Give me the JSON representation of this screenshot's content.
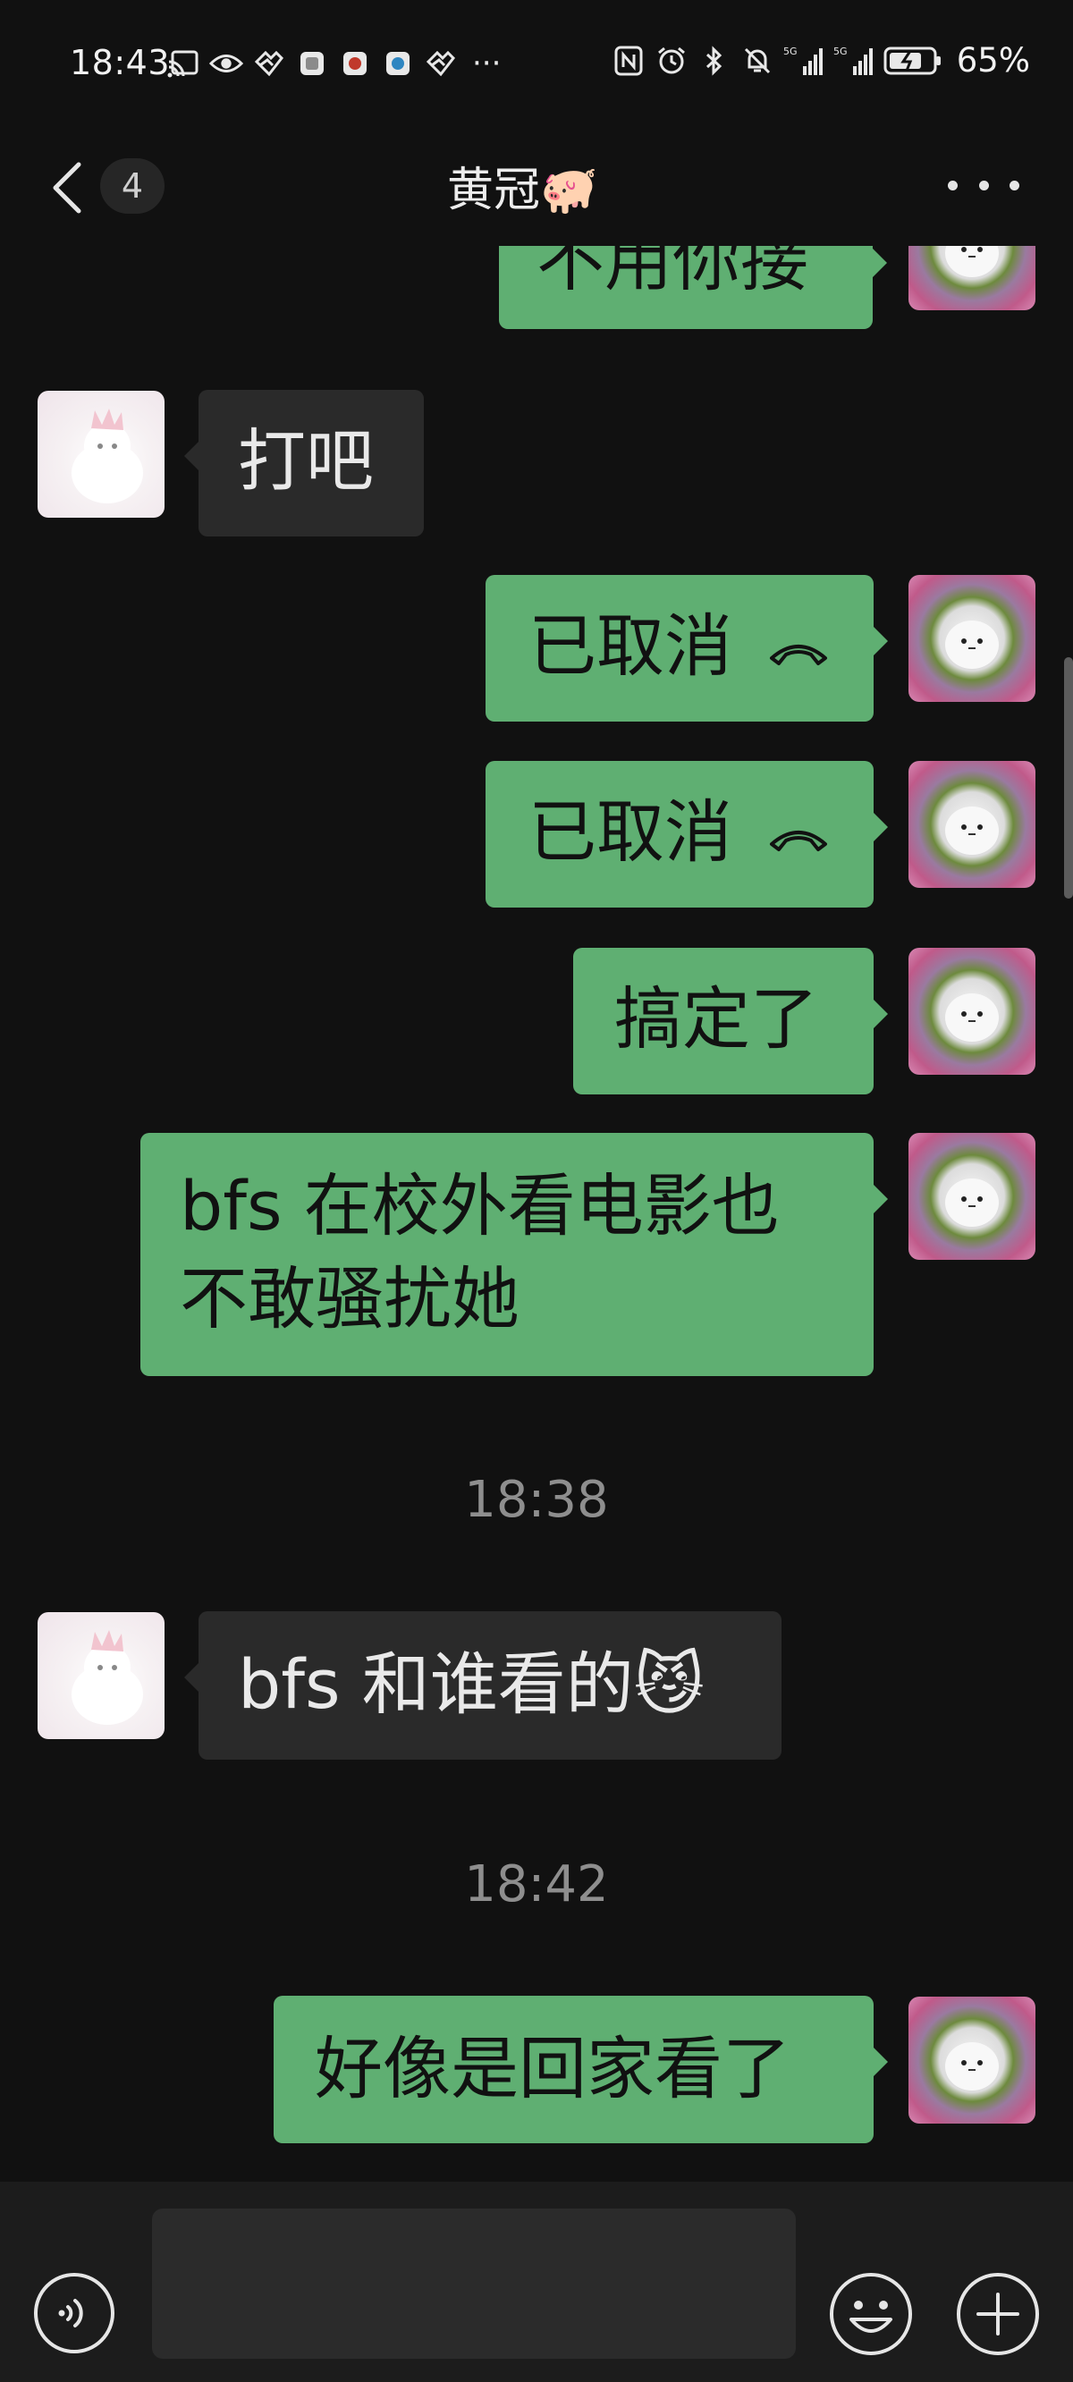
{
  "status_bar": {
    "time": "18:43",
    "network_label_1": "5G",
    "network_label_2": "5G",
    "battery_percent": "65%"
  },
  "header": {
    "unread_count": "4",
    "title": "黄冠🐖"
  },
  "messages": [
    {
      "side": "out",
      "text": "不用你接"
    },
    {
      "side": "in",
      "text": "打吧"
    },
    {
      "side": "out",
      "text": "已取消",
      "icon": "phone-hangup-icon"
    },
    {
      "side": "out",
      "text": "已取消",
      "icon": "phone-hangup-icon"
    },
    {
      "side": "out",
      "text": "搞定了"
    },
    {
      "side": "out",
      "text": "bfs 在校外看电影也不敢骚扰她"
    },
    {
      "time_separator": "18:38"
    },
    {
      "side": "in",
      "text": "bfs 和谁看的😼"
    },
    {
      "time_separator": "18:42"
    },
    {
      "side": "out",
      "text": "好像是回家看了"
    }
  ],
  "input_bar": {
    "text_value": "",
    "placeholder": ""
  },
  "colors": {
    "background": "#111111",
    "outgoing_bubble": "#5faf72",
    "incoming_bubble": "#2a2a2a",
    "input_bar": "#1c1c1c"
  }
}
